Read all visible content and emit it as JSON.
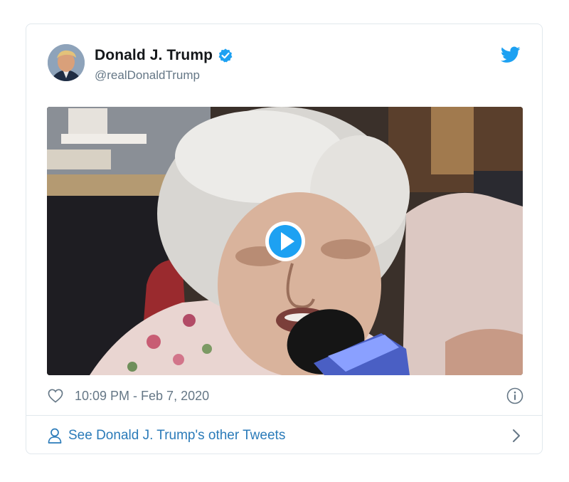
{
  "tweet": {
    "author_name": "Donald J. Trump",
    "handle": "@realDonaldTrump",
    "timestamp": "10:09 PM - Feb 7, 2020",
    "footer_link": "See Donald J. Trump's other Tweets"
  },
  "icons": {
    "verified": "verified-badge-icon",
    "brand": "twitter-bird-icon",
    "media_control": "play-icon",
    "like": "heart-icon",
    "info": "info-icon",
    "profile": "person-icon",
    "more": "chevron-right-icon"
  },
  "colors": {
    "brand_blue": "#1da1f2",
    "link_blue": "#2b7bb9",
    "secondary_text": "#657786",
    "border": "#e1e8ed"
  }
}
